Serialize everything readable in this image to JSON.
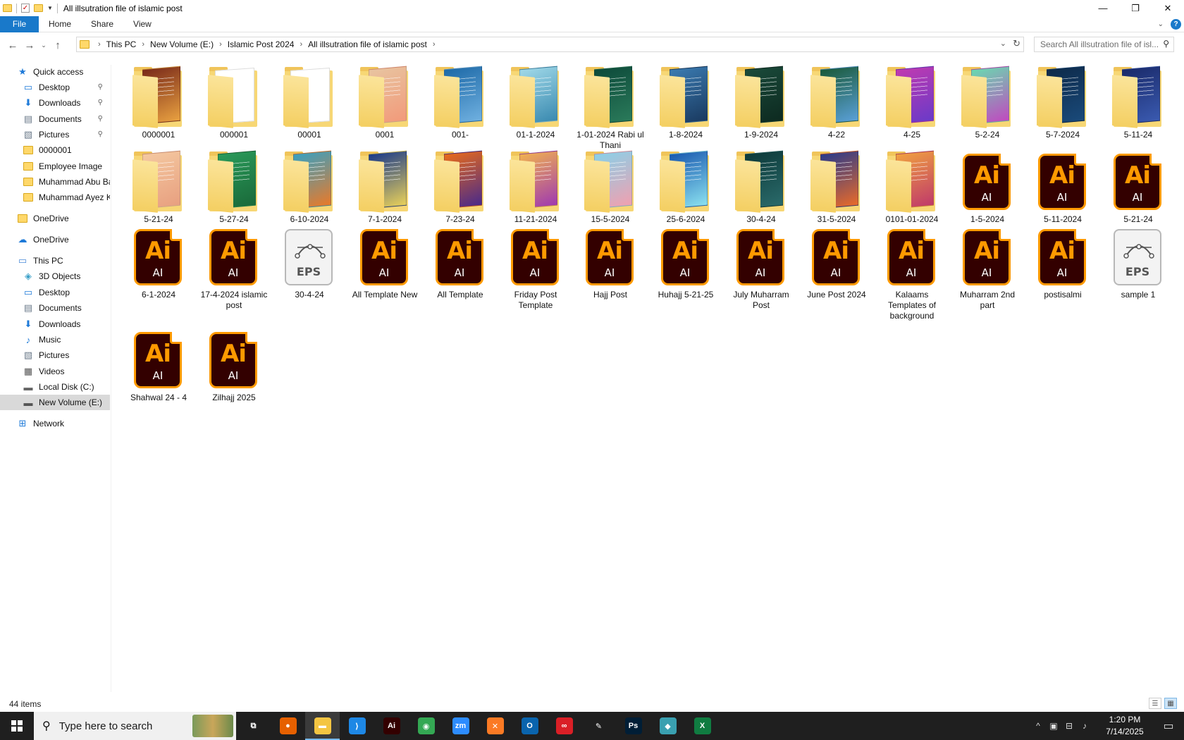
{
  "window": {
    "title": "All illsutration file of islamic post",
    "controls": {
      "minimize": "—",
      "maximize": "❐",
      "close": "✕"
    }
  },
  "ribbon": {
    "tabs": [
      {
        "label": "File",
        "active": true
      },
      {
        "label": "Home"
      },
      {
        "label": "Share"
      },
      {
        "label": "View"
      }
    ]
  },
  "address": {
    "breadcrumb": [
      "This PC",
      "New Volume (E:)",
      "Islamic Post 2024",
      "All illsutration file of islamic post"
    ],
    "search_placeholder": "Search All illsutration file of isl..."
  },
  "sidebar": {
    "items": [
      {
        "label": "Quick access",
        "icon": "star-icon",
        "kind": "section"
      },
      {
        "label": "Desktop",
        "icon": "desktop-icon",
        "pinned": true
      },
      {
        "label": "Downloads",
        "icon": "download-icon",
        "pinned": true
      },
      {
        "label": "Documents",
        "icon": "documents-icon",
        "pinned": true
      },
      {
        "label": "Pictures",
        "icon": "pictures-icon",
        "pinned": true
      },
      {
        "label": "0000001",
        "icon": "folder-icon"
      },
      {
        "label": "Employee Image",
        "icon": "folder-icon"
      },
      {
        "label": "Muhammad Abu Ba",
        "icon": "folder-icon"
      },
      {
        "label": "Muhammad Ayez K",
        "icon": "folder-icon"
      },
      {
        "label": "OneDrive",
        "icon": "folder-icon",
        "kind": "section"
      },
      {
        "label": "OneDrive",
        "icon": "cloud-icon",
        "kind": "section"
      },
      {
        "label": "This PC",
        "icon": "computer-icon",
        "kind": "section"
      },
      {
        "label": "3D Objects",
        "icon": "cube-icon"
      },
      {
        "label": "Desktop",
        "icon": "desktop-icon"
      },
      {
        "label": "Documents",
        "icon": "documents-icon"
      },
      {
        "label": "Downloads",
        "icon": "download-icon"
      },
      {
        "label": "Music",
        "icon": "music-icon"
      },
      {
        "label": "Pictures",
        "icon": "pictures-icon"
      },
      {
        "label": "Videos",
        "icon": "videos-icon"
      },
      {
        "label": "Local Disk (C:)",
        "icon": "disk-icon"
      },
      {
        "label": "New Volume (E:)",
        "icon": "drive-icon",
        "selected": true
      },
      {
        "label": "Network",
        "icon": "network-icon",
        "kind": "section"
      }
    ]
  },
  "files": [
    {
      "name": "0000001",
      "type": "folder",
      "colors": [
        "#7a2a1a",
        "#e8a040"
      ]
    },
    {
      "name": "000001",
      "type": "folder-empty"
    },
    {
      "name": "00001",
      "type": "folder-empty"
    },
    {
      "name": "0001",
      "type": "folder",
      "colors": [
        "#e8c4a0",
        "#f29a7a"
      ]
    },
    {
      "name": "001-",
      "type": "folder",
      "colors": [
        "#1e6aa8",
        "#6fb0e0"
      ]
    },
    {
      "name": "01-1-2024",
      "type": "folder",
      "colors": [
        "#9fd8e8",
        "#3a8ab0"
      ]
    },
    {
      "name": "1-01-2024 Rabi ul Thani",
      "type": "folder",
      "colors": [
        "#0d4a3a",
        "#2a7a5a"
      ]
    },
    {
      "name": "1-8-2024",
      "type": "folder",
      "colors": [
        "#3a7ab0",
        "#1a3a60"
      ]
    },
    {
      "name": "1-9-2024",
      "type": "folder",
      "colors": [
        "#1a4a3a",
        "#0d2a20"
      ]
    },
    {
      "name": "4-22",
      "type": "folder",
      "colors": [
        "#1a5a3a",
        "#5aa0d8"
      ]
    },
    {
      "name": "4-25",
      "type": "folder",
      "colors": [
        "#c03ab0",
        "#6a3ac8"
      ]
    },
    {
      "name": "5-2-24",
      "type": "folder",
      "colors": [
        "#6ad8b0",
        "#c04ac0"
      ]
    },
    {
      "name": "5-7-2024",
      "type": "folder",
      "colors": [
        "#0d2a4a",
        "#1a4a7a"
      ]
    },
    {
      "name": "5-11-24",
      "type": "folder",
      "colors": [
        "#1a2a6a",
        "#3a5ab0"
      ]
    },
    {
      "name": "5-21-24",
      "type": "folder",
      "colors": [
        "#f4c8a0",
        "#e8a080"
      ]
    },
    {
      "name": "5-27-24",
      "type": "folder",
      "colors": [
        "#2a9a5a",
        "#1a6a3a"
      ]
    },
    {
      "name": "6-10-2024",
      "type": "folder",
      "colors": [
        "#3aa0c0",
        "#e87a2a"
      ]
    },
    {
      "name": "7-1-2024",
      "type": "folder",
      "colors": [
        "#1a3a8a",
        "#e8d05a"
      ]
    },
    {
      "name": "7-23-24",
      "type": "folder",
      "colors": [
        "#e86a1a",
        "#4a2a8a"
      ]
    },
    {
      "name": "11-21-2024",
      "type": "folder",
      "colors": [
        "#f0b050",
        "#a03ab0"
      ]
    },
    {
      "name": "15-5-2024",
      "type": "folder",
      "colors": [
        "#8ad0e8",
        "#f0a0b0"
      ]
    },
    {
      "name": "25-6-2024",
      "type": "folder",
      "colors": [
        "#1a5ab0",
        "#8ae0f0"
      ]
    },
    {
      "name": "30-4-24",
      "type": "folder",
      "colors": [
        "#0d3a3a",
        "#2a6a6a"
      ]
    },
    {
      "name": "31-5-2024",
      "type": "folder",
      "colors": [
        "#2a3a8a",
        "#e86a2a"
      ]
    },
    {
      "name": "0101-01-2024",
      "type": "folder",
      "colors": [
        "#f0a040",
        "#c03a6a"
      ]
    },
    {
      "name": "1-5-2024",
      "type": "ai"
    },
    {
      "name": "5-11-2024",
      "type": "ai"
    },
    {
      "name": "5-21-24",
      "type": "ai"
    },
    {
      "name": "6-1-2024",
      "type": "ai"
    },
    {
      "name": "17-4-2024 islamic post",
      "type": "ai"
    },
    {
      "name": "30-4-24",
      "type": "eps"
    },
    {
      "name": "All Template New",
      "type": "ai"
    },
    {
      "name": "All Template",
      "type": "ai"
    },
    {
      "name": "Friday Post Template",
      "type": "ai"
    },
    {
      "name": "Hajj Post",
      "type": "ai"
    },
    {
      "name": "Huhajj 5-21-25",
      "type": "ai"
    },
    {
      "name": "July Muharram Post",
      "type": "ai"
    },
    {
      "name": "June Post 2024",
      "type": "ai"
    },
    {
      "name": "Kalaams Templates of background",
      "type": "ai"
    },
    {
      "name": "Muharram 2nd part",
      "type": "ai"
    },
    {
      "name": "postisalmi",
      "type": "ai"
    },
    {
      "name": "sample 1",
      "type": "eps"
    },
    {
      "name": "Shahwal 24 - 4",
      "type": "ai"
    },
    {
      "name": "Zilhajj 2025",
      "type": "ai"
    }
  ],
  "icons": {
    "ai_big": "Ai",
    "ai_small": "AI",
    "eps": "EPS"
  },
  "status": {
    "item_count": "44 items"
  },
  "taskbar": {
    "search_placeholder": "Type here to search",
    "apps": [
      {
        "name": "task-view",
        "glyph": "⧉",
        "bg": "transparent"
      },
      {
        "name": "firefox",
        "glyph": "●",
        "bg": "#e66000"
      },
      {
        "name": "file-explorer",
        "glyph": "▬",
        "bg": "#f4c542",
        "active": true
      },
      {
        "name": "vscode",
        "glyph": "⟩",
        "bg": "#1e88e5"
      },
      {
        "name": "illustrator",
        "glyph": "Ai",
        "bg": "#330000"
      },
      {
        "name": "chrome",
        "glyph": "◉",
        "bg": "#34a853"
      },
      {
        "name": "zoom",
        "glyph": "zm",
        "bg": "#2d8cff"
      },
      {
        "name": "xampp",
        "glyph": "✕",
        "bg": "#fb7a24"
      },
      {
        "name": "outlook",
        "glyph": "O",
        "bg": "#0a64ad"
      },
      {
        "name": "creative-cloud",
        "glyph": "∞",
        "bg": "#da1f26"
      },
      {
        "name": "pen-tool",
        "glyph": "✎",
        "bg": "transparent"
      },
      {
        "name": "photoshop",
        "glyph": "Ps",
        "bg": "#001e36"
      },
      {
        "name": "app-diamond",
        "glyph": "◆",
        "bg": "#3aa0b0"
      },
      {
        "name": "excel",
        "glyph": "X",
        "bg": "#107c41"
      }
    ],
    "time": "1:20 PM",
    "date": "7/14/2025"
  }
}
